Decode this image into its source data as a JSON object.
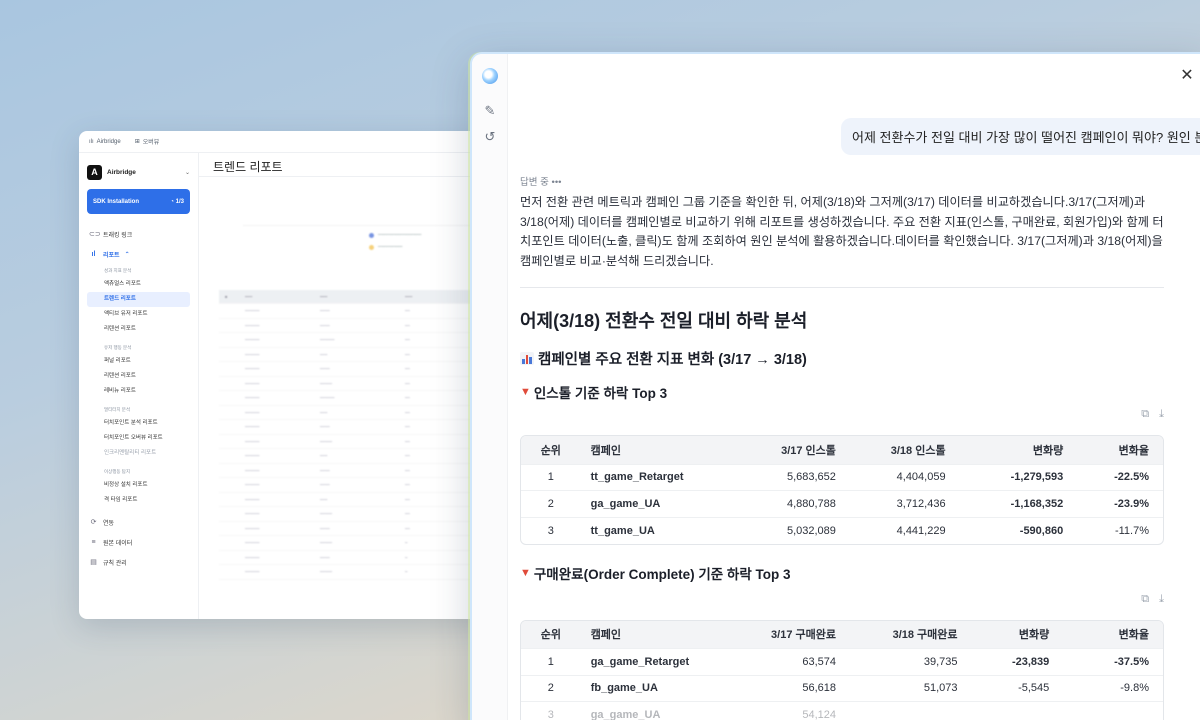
{
  "bg_app": {
    "topbar": {
      "org": "Airbridge",
      "view": "오버뷰"
    },
    "workspace": {
      "name": "Airbridge"
    },
    "sdk": {
      "label": "SDK Installation",
      "progress": "1/3"
    },
    "nav": {
      "tracking_link": "트래킹 링크",
      "reports": "리포트",
      "group_performance": "성과 지표 분석",
      "actuals": "액츄얼스 리포트",
      "trend": "트렌드 리포트",
      "active_users": "액티브 유저 리포트",
      "retention_group": "리텐션 리포트",
      "group_user_behavior": "유저 행동 분석",
      "funnel": "퍼널 리포트",
      "retention": "리텐션 리포트",
      "revenue": "레비뉴 리포트",
      "group_multitouch": "멀티터치 분석",
      "touchpoint_analysis": "터치포인트 분석 리포트",
      "touchpoint_overview": "터치포인트 오버뷰 리포트",
      "hidden": "인크리멘탈리티 리포트",
      "group_anomaly": "이상행동 탐지",
      "abnormal_install": "비정상 설치 리포트",
      "ctit": "격 타임 리포트",
      "integrations": "연동",
      "raw_data": "원본 데이터",
      "rules": "규칙 관리"
    },
    "page_title": "트렌드 리포트"
  },
  "chat": {
    "user_message": "어제 전환수가 전일 대비 가장 많이 떨어진 캠페인이 뭐야? 원인 분석해줘.",
    "status": "답변 중 •••",
    "intro": "먼저 전환 관련 메트릭과 캠페인 그룹 기준을 확인한 뒤, 어제(3/18)와 그저께(3/17) 데이터를 비교하겠습니다.3/17(그저께)과 3/18(어제) 데이터를 캠페인별로 비교하기 위해 리포트를 생성하겠습니다. 주요 전환 지표(인스톨, 구매완료, 회원가입)와 함께 터치포인트 데이터(노출, 클릭)도 함께 조회하여 원인 분석에 활용하겠습니다.데이터를 확인했습니다. 3/17(그저께)과 3/18(어제)을 캠페인별로 비교·분석해 드리겠습니다.",
    "report_title": "어제(3/18) 전환수 전일 대비 하락 분석",
    "section_title": "캠페인별 주요 전환 지표 변화 (3/17 → 3/18)",
    "install": {
      "title": "인스톨 기준 하락 Top 3",
      "headers": [
        "순위",
        "캠페인",
        "3/17 인스톨",
        "3/18 인스톨",
        "변화량",
        "변화율"
      ],
      "rows": [
        [
          "1",
          "tt_game_Retarget",
          "5,683,652",
          "4,404,059",
          "-1,279,593",
          "-22.5%"
        ],
        [
          "2",
          "ga_game_UA",
          "4,880,788",
          "3,712,436",
          "-1,168,352",
          "-23.9%"
        ],
        [
          "3",
          "tt_game_UA",
          "5,032,089",
          "4,441,229",
          "-590,860",
          "-11.7%"
        ]
      ]
    },
    "order": {
      "title": "구매완료(Order Complete) 기준 하락 Top 3",
      "headers": [
        "순위",
        "캠페인",
        "3/17 구매완료",
        "3/18 구매완료",
        "변화량",
        "변화율"
      ],
      "rows": [
        [
          "1",
          "ga_game_Retarget",
          "63,574",
          "39,735",
          "-23,839",
          "-37.5%"
        ],
        [
          "2",
          "fb_game_UA",
          "56,618",
          "51,073",
          "-5,545",
          "-9.8%"
        ],
        [
          "3",
          "ga_game_UA",
          "54,124",
          "",
          "",
          ""
        ]
      ]
    }
  }
}
